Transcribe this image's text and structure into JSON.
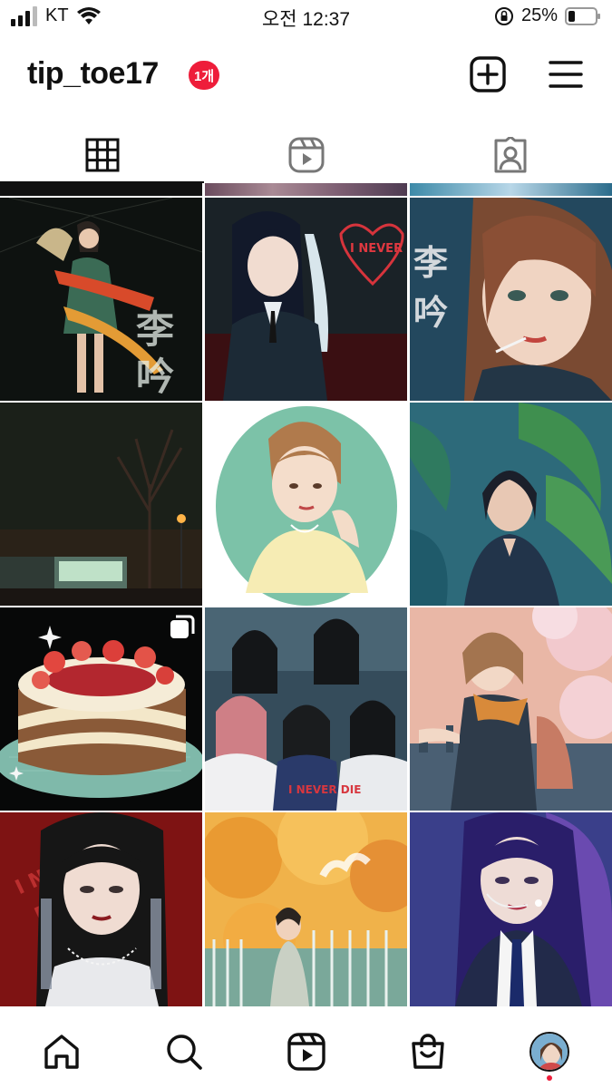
{
  "status_bar": {
    "carrier": "KT",
    "time": "오전 12:37",
    "battery": "25%",
    "icons": [
      "signal-bars-icon",
      "wifi-icon",
      "orientation-lock-icon",
      "battery-icon"
    ],
    "battery_level": 0.25
  },
  "header": {
    "username": "tip_toe17",
    "notification_badge": "1개",
    "icons": [
      "new-post-icon",
      "menu-icon"
    ],
    "badge_color": "#ee1d3a"
  },
  "tabs": [
    {
      "name": "posts-grid",
      "icon": "grid-icon",
      "active": true
    },
    {
      "name": "reels",
      "icon": "reels-icon",
      "active": false
    },
    {
      "name": "tagged",
      "icon": "tagged-icon",
      "active": false
    }
  ],
  "posts": [
    {
      "id": "p1",
      "subject": "woman with fan and sash",
      "caption_glyphs": "李\n吟",
      "multi": false
    },
    {
      "id": "p2",
      "subject": "girl in dark suit",
      "caption_glyphs": "I NEVER DIE",
      "multi": false
    },
    {
      "id": "p3",
      "subject": "girl with lollipop",
      "caption_glyphs": "李\n吟",
      "multi": false
    },
    {
      "id": "p4",
      "subject": "night street with tree",
      "multi": false
    },
    {
      "id": "p5",
      "subject": "girl in yellow dress oval",
      "multi": false
    },
    {
      "id": "p6",
      "subject": "girl among tropical leaves",
      "multi": false
    },
    {
      "id": "p7",
      "subject": "strawberry cake",
      "multi": true
    },
    {
      "id": "p8",
      "subject": "group of five girls",
      "multi": false
    },
    {
      "id": "p9",
      "subject": "girl under cherry blossoms",
      "multi": false
    },
    {
      "id": "p10",
      "subject": "girl with earrings on red",
      "multi": false
    },
    {
      "id": "p11",
      "subject": "autumn trees and fence",
      "multi": false
    },
    {
      "id": "p12",
      "subject": "girl with headset mic",
      "multi": false
    }
  ],
  "bottom_nav": [
    {
      "name": "home",
      "icon": "home-icon"
    },
    {
      "name": "search",
      "icon": "search-icon"
    },
    {
      "name": "reels",
      "icon": "reels-icon"
    },
    {
      "name": "shop",
      "icon": "shop-icon"
    },
    {
      "name": "profile",
      "icon": "profile-avatar-icon"
    }
  ]
}
